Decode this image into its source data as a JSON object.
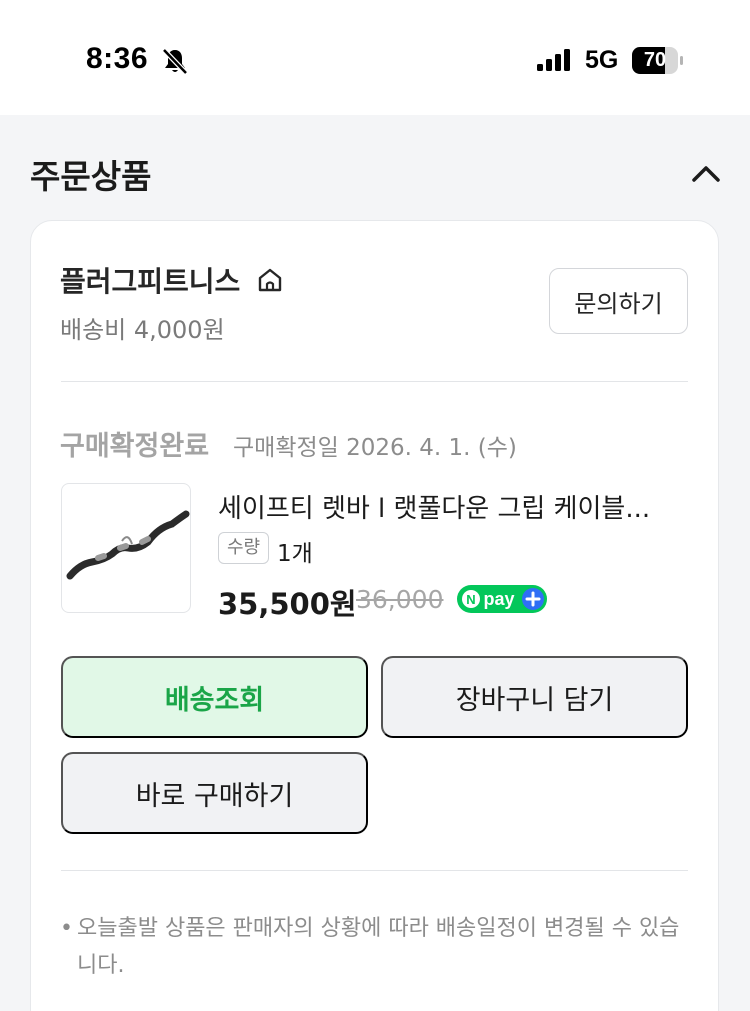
{
  "status_bar": {
    "time": "8:36",
    "network": "5G",
    "battery": "70"
  },
  "section": {
    "title": "주문상품"
  },
  "seller": {
    "name": "플러그피트니스",
    "shipping_fee": "배송비 4,000원",
    "inquiry_label": "문의하기"
  },
  "order": {
    "status": "구매확정완료",
    "confirm_date": "구매확정일 2026. 4. 1. (수)"
  },
  "product": {
    "name": "세이프티 렛바 l 랫풀다운 그립 케이블...",
    "qty_label": "수량",
    "qty_value": "1개",
    "price": "35,500원",
    "original_price": "36,000",
    "npay_text": "pay"
  },
  "actions": {
    "tracking": "배송조회",
    "add_to_cart": "장바구니 담기",
    "buy_now": "바로 구매하기"
  },
  "notice": {
    "text": "오늘출발 상품은 판매자의 상황에 따라 배송일정이 변경될 수 있습니다."
  },
  "colors": {
    "accent_green": "#1aa548",
    "tracking_bg": "#e1f8e7",
    "npay_green": "#03c75a",
    "npay_blue": "#2f6ff5"
  },
  "icons": {
    "bell": "bell-slash-icon",
    "signal": "signal-bars-icon",
    "battery": "battery-icon",
    "collapse": "chevron-up-icon",
    "store": "home-icon"
  }
}
